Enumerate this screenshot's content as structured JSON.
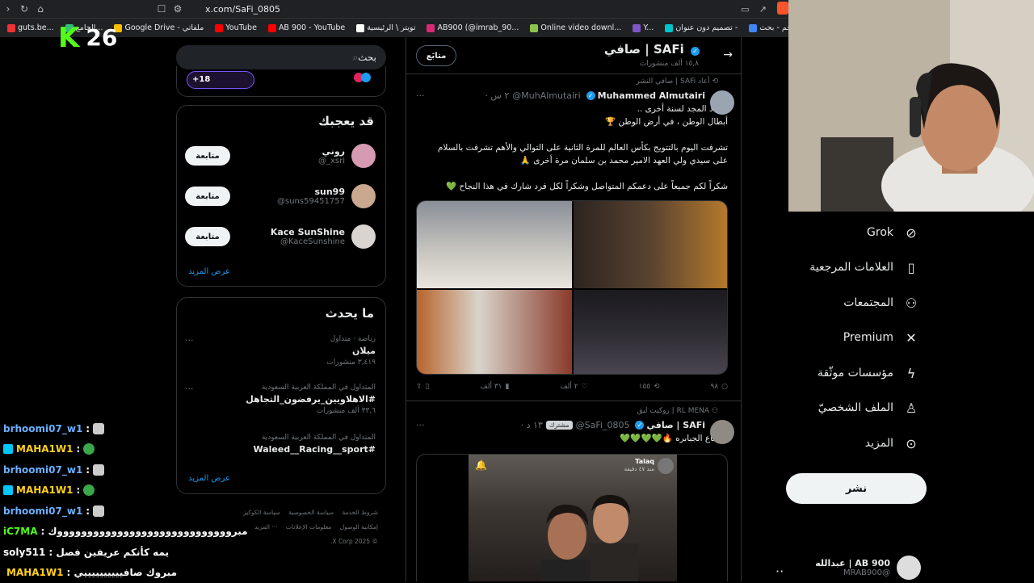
{
  "browser": {
    "url": "x.com/SaFi_0805",
    "bookmarks": [
      {
        "label": "guts.be...",
        "color": "#e33"
      },
      {
        "label": "الجامع...",
        "color": "#3b7"
      },
      {
        "label": "Google Drive - ملفاتي",
        "color": "#fbbc04"
      },
      {
        "label": "YouTube",
        "color": "#f00"
      },
      {
        "label": "AB 900 - YouTube",
        "color": "#f00"
      },
      {
        "label": "تويتر \\ الرئيسية",
        "color": "#fff"
      },
      {
        "label": "AB900 (@imrab_90...",
        "color": "#d62976"
      },
      {
        "label": "Online video downl...",
        "color": "#8bc34a"
      },
      {
        "label": "Y...",
        "color": "#7e57c2"
      },
      {
        "label": "تصميم دون عنوان -",
        "color": "#00c4cc"
      },
      {
        "label": "جم - بحث Google",
        "color": "#4285f4"
      }
    ]
  },
  "overlay": {
    "kick_logo": "K",
    "viewers": "26"
  },
  "sidebar_left": {
    "search_placeholder": "بحث",
    "spaces_count": "+18",
    "who_to_follow": {
      "title": "قد يعجبك",
      "users": [
        {
          "name": "روني",
          "handle": "@_xsri",
          "button": "متابعة"
        },
        {
          "name": "sun99",
          "handle": "@suns59451757",
          "button": "متابعة"
        },
        {
          "name": "Kace SunShine",
          "handle": "@KaceSunshine",
          "button": "متابعة"
        }
      ],
      "show_more": "عرض المزيد"
    },
    "trends": {
      "title": "ما يحدث",
      "items": [
        {
          "meta": "رياضة · متداول",
          "title": "ميلان",
          "count": "٣,٤١٩ منشورات"
        },
        {
          "meta": "المتداول في المملكة العربية السعودية",
          "title": "#الاهلاويين_يرفضون_التجاهل",
          "count": "٣٣,٦ ألف منشورات"
        },
        {
          "meta": "المتداول في المملكة العربية السعودية",
          "title": "#Waleed__Racing__sport",
          "count": ""
        }
      ],
      "show_more": "عرض المزيد"
    },
    "footer": {
      "links": [
        "شروط الخدمة",
        "سياسة الخصوصية",
        "سياسة الكوكيز",
        "إمكانية الوصول",
        "معلومات الإعلانات",
        "··· المزيد"
      ],
      "copyright": "© 2025 X Corp."
    }
  },
  "profile_header": {
    "title": "صافي | SAFi",
    "posts_count": "١٥,٨ ألف منشورات",
    "follow_button": "متابَع"
  },
  "tweets": [
    {
      "repost_label": "أعاد SAFi | صافي النشر",
      "author": "Muhammed Almutairi",
      "handle": "@MuhAlmutairi",
      "time": "٢ س",
      "lines": [
        "يتجدد المجد لسنة أخرى ..",
        "أبطال الوطن ، في أرض الوطن 🏆",
        "",
        "تشرفت اليوم بالتتويج بكأس العالم للمرة الثانية على التوالي والأهم تشرفت بالسلام",
        "على سيدي ولي العهد الامير محمد بن سلمان مرة أخرى 🙏",
        "",
        "شكراً لكم جميعاً على دعمكم المتواصل وشكراً لكل فرد شارك في هذا النجاح 💚"
      ],
      "actions": {
        "replies": "٩٨",
        "reposts": "١٥٥",
        "likes": "٢ ألف",
        "views": "٣١ ألف"
      }
    },
    {
      "repost_label": "RL MENA | روكيت ليق",
      "author": "SAFi | صافي",
      "handle": "@SaFi_0805",
      "badge": "مشترك",
      "time": "١٣ د",
      "text": "اجتماع الجبابره 🔥💚💚💚💚",
      "video_channel": "Talaq",
      "video_time": "منذ ٤٧ دقيقة"
    }
  ],
  "nav": {
    "items": [
      {
        "label": "Grok",
        "icon": "grok-icon"
      },
      {
        "label": "العلامات المرجعية",
        "icon": "bookmark-icon"
      },
      {
        "label": "المجتمعات",
        "icon": "communities-icon"
      },
      {
        "label": "Premium",
        "icon": "x-logo-icon"
      },
      {
        "label": "مؤسسات موثّقة",
        "icon": "lightning-icon"
      },
      {
        "label": "الملف الشخصيّ",
        "icon": "profile-icon"
      },
      {
        "label": "المزيد",
        "icon": "more-icon"
      }
    ],
    "post_button": "نشر",
    "account": {
      "name": "AB 900 | عبدالله",
      "handle": "@MRAB900"
    }
  },
  "chat": [
    {
      "user": "brhoomi07_w1",
      "color": "#6ab0ff",
      "msg": ":"
    },
    {
      "user": "MAHA1W1",
      "color": "#ffd11a",
      "msg": ":"
    },
    {
      "user": "brhoomi07_w1",
      "color": "#6ab0ff",
      "msg": ":"
    },
    {
      "user": "MAHA1W1",
      "color": "#ffd11a",
      "msg": ":"
    },
    {
      "user": "brhoomi07_w1",
      "color": "#6ab0ff",
      "msg": ":"
    },
    {
      "user": "iC7MA",
      "color": "#53fc18",
      "msg": ": مبروووووووووووووووووووووووووووووك"
    },
    {
      "user": "soly511",
      "color": "#ffffff",
      "msg": ": يمه كأنكم عريفين فصل"
    },
    {
      "user": "MAHA1W1",
      "color": "#ffd11a",
      "msg": ": مبروك صافييييييييييي"
    }
  ]
}
